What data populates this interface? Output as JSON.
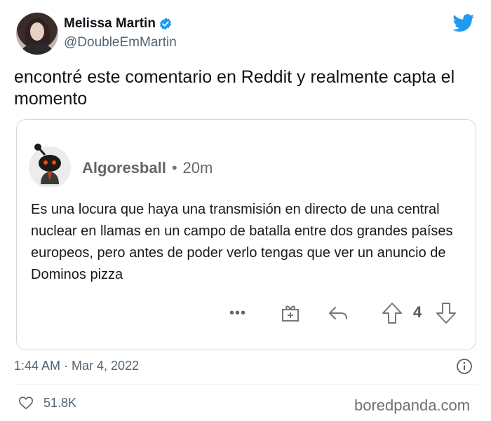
{
  "author": {
    "display_name": "Melissa Martin",
    "handle": "@DoubleEmMartin"
  },
  "tweet": {
    "text": "encontré este comentario en Reddit y realmente capta el momento"
  },
  "reddit_comment": {
    "username": "Algoresball",
    "separator": "•",
    "age": "20m",
    "body": "Es una locura que haya una transmisión en directo de una central nuclear en llamas en un campo de batalla entre dos grandes países europeos, pero antes de poder verlo tengas que ver un anuncio de Dominos pizza",
    "more_label": "•••",
    "vote_count": "4"
  },
  "meta": {
    "timestamp": "1:44 AM · Mar 4, 2022",
    "likes": "51.8K"
  },
  "watermark": "boredpanda.com",
  "colors": {
    "twitter_blue": "#1d9bf0",
    "secondary_text": "#536471",
    "card_border": "#cfd9de"
  },
  "icons": [
    "verified-badge-icon",
    "twitter-bird-icon",
    "reddit-snoo-icon",
    "gift-icon",
    "reply-icon",
    "upvote-icon",
    "downvote-icon",
    "info-icon",
    "heart-icon"
  ]
}
